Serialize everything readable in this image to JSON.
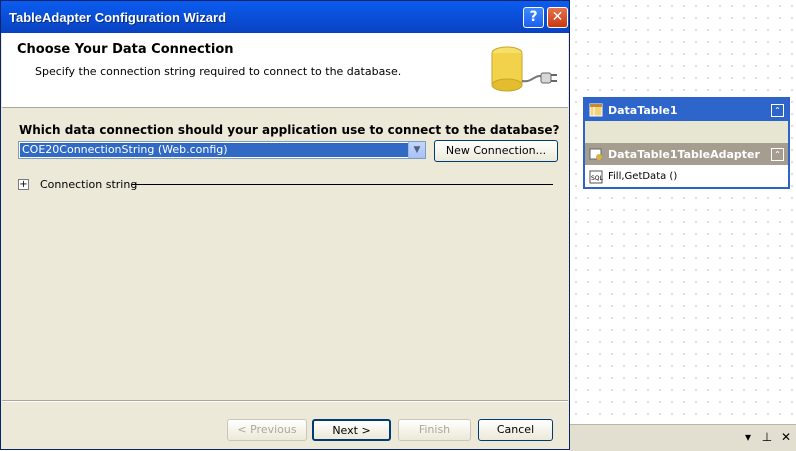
{
  "designer": {
    "datatable": {
      "title": "DataTable1"
    },
    "adapter": {
      "title": "DataTable1TableAdapter",
      "query": "Fill,GetData ()"
    },
    "dock_icons": [
      "pin-icon",
      "dropdown-icon",
      "close-icon"
    ]
  },
  "wizard": {
    "title": "TableAdapter Configuration Wizard",
    "help_label": "?",
    "close_label": "✕",
    "header_title": "Choose Your Data Connection",
    "header_subtitle": "Specify the connection string required to connect to the database.",
    "question": "Which data connection should your application use to connect to the database?",
    "connection_value": "COE20ConnectionString (Web.config)",
    "new_connection_label": "New Connection...",
    "connection_string_label": "Connection string",
    "buttons": {
      "previous": "< Previous",
      "next": "Next >",
      "finish": "Finish",
      "cancel": "Cancel"
    }
  },
  "colors": {
    "title_bar": "#0a4fd9",
    "selection": "#316ac5",
    "datatable_header": "#2d65cb"
  }
}
